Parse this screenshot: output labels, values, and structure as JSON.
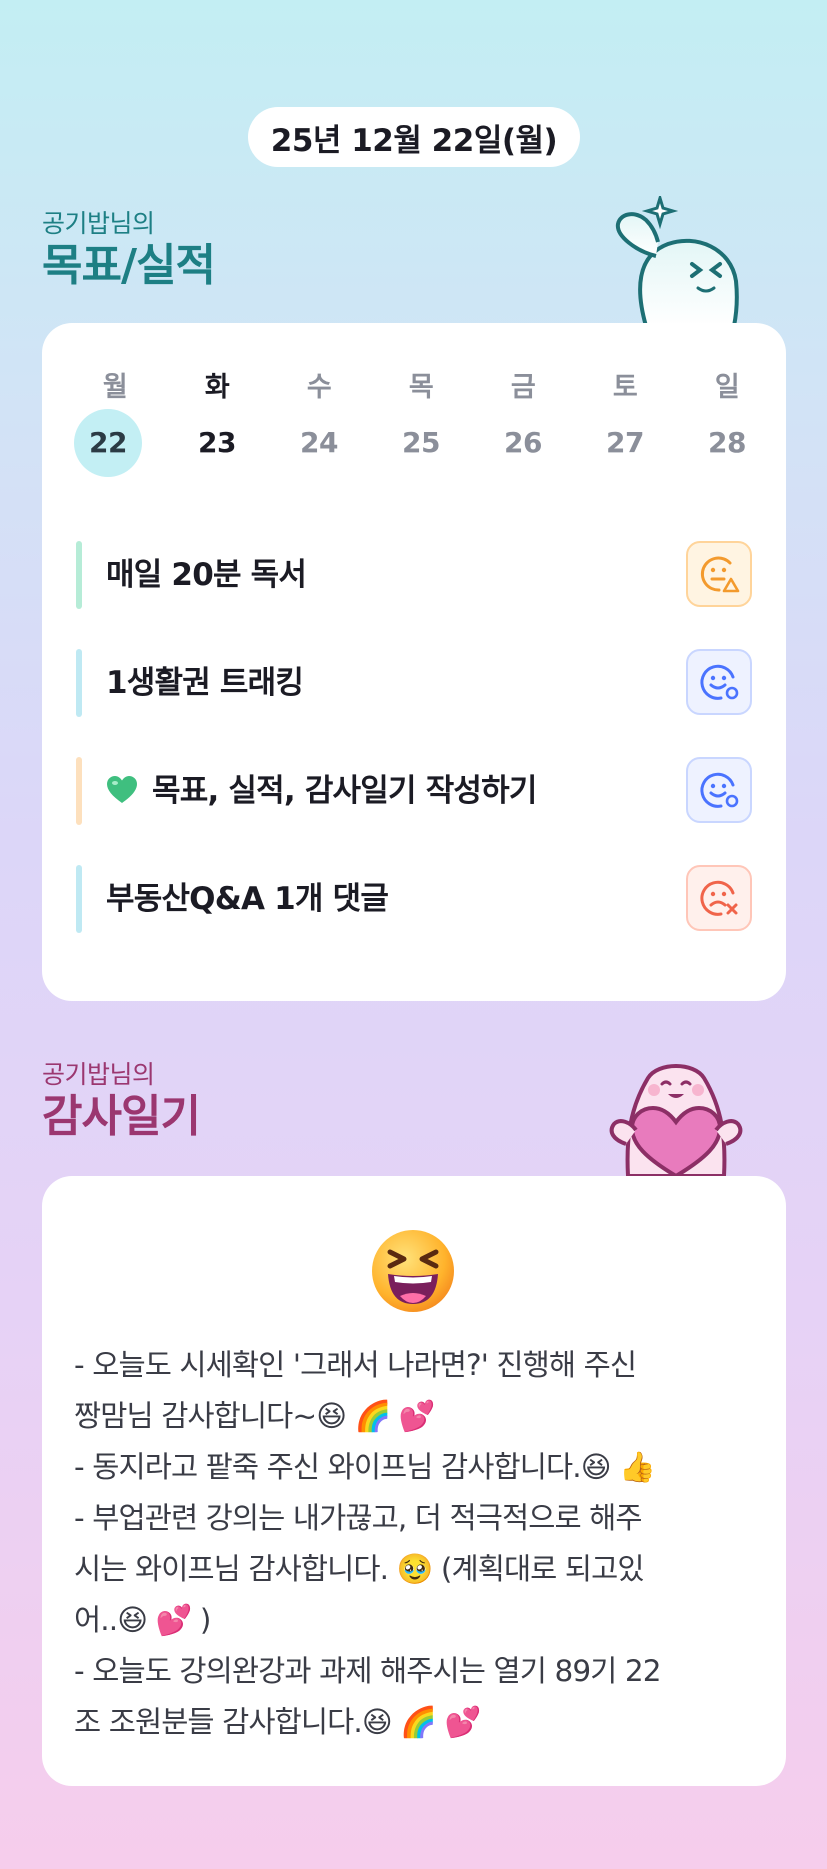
{
  "date_label": "25년 12월 22일(월)",
  "goal_section": {
    "subtitle": "공기밥님의",
    "title": "목표/실적"
  },
  "week": {
    "days": [
      {
        "name": "월",
        "num": "22",
        "state": "today"
      },
      {
        "name": "화",
        "num": "23",
        "state": "dark"
      },
      {
        "name": "수",
        "num": "24",
        "state": "muted"
      },
      {
        "name": "목",
        "num": "25",
        "state": "muted"
      },
      {
        "name": "금",
        "num": "26",
        "state": "muted"
      },
      {
        "name": "토",
        "num": "27",
        "state": "muted"
      },
      {
        "name": "일",
        "num": "28",
        "state": "muted"
      }
    ]
  },
  "goals": [
    {
      "label": "매일 20분 독서",
      "bar_color": "#b6ecd7",
      "status": "warning",
      "status_color": "#f39a2d"
    },
    {
      "label": "1생활권 트래킹",
      "bar_color": "#bfe9f3",
      "status": "done",
      "status_color": "#4a73ff"
    },
    {
      "label": "목표, 실적, 감사일기 작성하기",
      "bar_color": "#fde0bd",
      "status": "done",
      "status_color": "#4a73ff",
      "icon": "green-heart-icon"
    },
    {
      "label": "부동산Q&A 1개 댓글",
      "bar_color": "#bfe9f3",
      "status": "fail",
      "status_color": "#f0644a"
    }
  ],
  "gratitude_section": {
    "subtitle": "공기밥님의",
    "title": "감사일기"
  },
  "gratitude": {
    "emoji": "grinning-squinting-face-icon",
    "lines": [
      "- 오늘도 시세확인 '그래서 나라면?' 진행해 주신",
      "짱맘님 감사합니다~😆 🌈 💕",
      "- 동지라고 팥죽 주신 와이프님 감사합니다.😆 👍",
      "- 부업관련 강의는 내가끊고, 더 적극적으로 해주",
      "시는 와이프님 감사합니다. 🥹 (계획대로 되고있",
      "어..😆 💕 )",
      "- 오늘도 강의완강과 과제 해주시는 열기 89기 22",
      "조 조원분들 감사합니다.😆 🌈 💕"
    ]
  }
}
